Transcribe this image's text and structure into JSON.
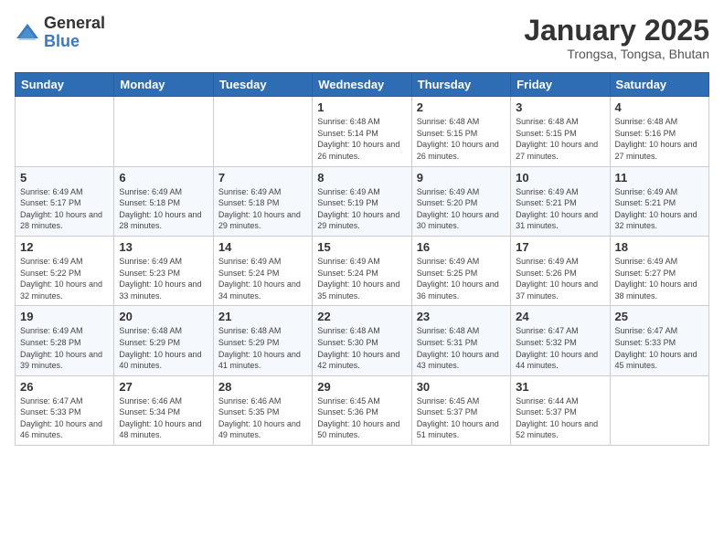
{
  "header": {
    "logo_general": "General",
    "logo_blue": "Blue",
    "month_title": "January 2025",
    "location": "Trongsa, Tongsa, Bhutan"
  },
  "weekdays": [
    "Sunday",
    "Monday",
    "Tuesday",
    "Wednesday",
    "Thursday",
    "Friday",
    "Saturday"
  ],
  "weeks": [
    [
      {
        "day": "",
        "info": ""
      },
      {
        "day": "",
        "info": ""
      },
      {
        "day": "",
        "info": ""
      },
      {
        "day": "1",
        "info": "Sunrise: 6:48 AM\nSunset: 5:14 PM\nDaylight: 10 hours and 26 minutes."
      },
      {
        "day": "2",
        "info": "Sunrise: 6:48 AM\nSunset: 5:15 PM\nDaylight: 10 hours and 26 minutes."
      },
      {
        "day": "3",
        "info": "Sunrise: 6:48 AM\nSunset: 5:15 PM\nDaylight: 10 hours and 27 minutes."
      },
      {
        "day": "4",
        "info": "Sunrise: 6:48 AM\nSunset: 5:16 PM\nDaylight: 10 hours and 27 minutes."
      }
    ],
    [
      {
        "day": "5",
        "info": "Sunrise: 6:49 AM\nSunset: 5:17 PM\nDaylight: 10 hours and 28 minutes."
      },
      {
        "day": "6",
        "info": "Sunrise: 6:49 AM\nSunset: 5:18 PM\nDaylight: 10 hours and 28 minutes."
      },
      {
        "day": "7",
        "info": "Sunrise: 6:49 AM\nSunset: 5:18 PM\nDaylight: 10 hours and 29 minutes."
      },
      {
        "day": "8",
        "info": "Sunrise: 6:49 AM\nSunset: 5:19 PM\nDaylight: 10 hours and 29 minutes."
      },
      {
        "day": "9",
        "info": "Sunrise: 6:49 AM\nSunset: 5:20 PM\nDaylight: 10 hours and 30 minutes."
      },
      {
        "day": "10",
        "info": "Sunrise: 6:49 AM\nSunset: 5:21 PM\nDaylight: 10 hours and 31 minutes."
      },
      {
        "day": "11",
        "info": "Sunrise: 6:49 AM\nSunset: 5:21 PM\nDaylight: 10 hours and 32 minutes."
      }
    ],
    [
      {
        "day": "12",
        "info": "Sunrise: 6:49 AM\nSunset: 5:22 PM\nDaylight: 10 hours and 32 minutes."
      },
      {
        "day": "13",
        "info": "Sunrise: 6:49 AM\nSunset: 5:23 PM\nDaylight: 10 hours and 33 minutes."
      },
      {
        "day": "14",
        "info": "Sunrise: 6:49 AM\nSunset: 5:24 PM\nDaylight: 10 hours and 34 minutes."
      },
      {
        "day": "15",
        "info": "Sunrise: 6:49 AM\nSunset: 5:24 PM\nDaylight: 10 hours and 35 minutes."
      },
      {
        "day": "16",
        "info": "Sunrise: 6:49 AM\nSunset: 5:25 PM\nDaylight: 10 hours and 36 minutes."
      },
      {
        "day": "17",
        "info": "Sunrise: 6:49 AM\nSunset: 5:26 PM\nDaylight: 10 hours and 37 minutes."
      },
      {
        "day": "18",
        "info": "Sunrise: 6:49 AM\nSunset: 5:27 PM\nDaylight: 10 hours and 38 minutes."
      }
    ],
    [
      {
        "day": "19",
        "info": "Sunrise: 6:49 AM\nSunset: 5:28 PM\nDaylight: 10 hours and 39 minutes."
      },
      {
        "day": "20",
        "info": "Sunrise: 6:48 AM\nSunset: 5:29 PM\nDaylight: 10 hours and 40 minutes."
      },
      {
        "day": "21",
        "info": "Sunrise: 6:48 AM\nSunset: 5:29 PM\nDaylight: 10 hours and 41 minutes."
      },
      {
        "day": "22",
        "info": "Sunrise: 6:48 AM\nSunset: 5:30 PM\nDaylight: 10 hours and 42 minutes."
      },
      {
        "day": "23",
        "info": "Sunrise: 6:48 AM\nSunset: 5:31 PM\nDaylight: 10 hours and 43 minutes."
      },
      {
        "day": "24",
        "info": "Sunrise: 6:47 AM\nSunset: 5:32 PM\nDaylight: 10 hours and 44 minutes."
      },
      {
        "day": "25",
        "info": "Sunrise: 6:47 AM\nSunset: 5:33 PM\nDaylight: 10 hours and 45 minutes."
      }
    ],
    [
      {
        "day": "26",
        "info": "Sunrise: 6:47 AM\nSunset: 5:33 PM\nDaylight: 10 hours and 46 minutes."
      },
      {
        "day": "27",
        "info": "Sunrise: 6:46 AM\nSunset: 5:34 PM\nDaylight: 10 hours and 48 minutes."
      },
      {
        "day": "28",
        "info": "Sunrise: 6:46 AM\nSunset: 5:35 PM\nDaylight: 10 hours and 49 minutes."
      },
      {
        "day": "29",
        "info": "Sunrise: 6:45 AM\nSunset: 5:36 PM\nDaylight: 10 hours and 50 minutes."
      },
      {
        "day": "30",
        "info": "Sunrise: 6:45 AM\nSunset: 5:37 PM\nDaylight: 10 hours and 51 minutes."
      },
      {
        "day": "31",
        "info": "Sunrise: 6:44 AM\nSunset: 5:37 PM\nDaylight: 10 hours and 52 minutes."
      },
      {
        "day": "",
        "info": ""
      }
    ]
  ]
}
